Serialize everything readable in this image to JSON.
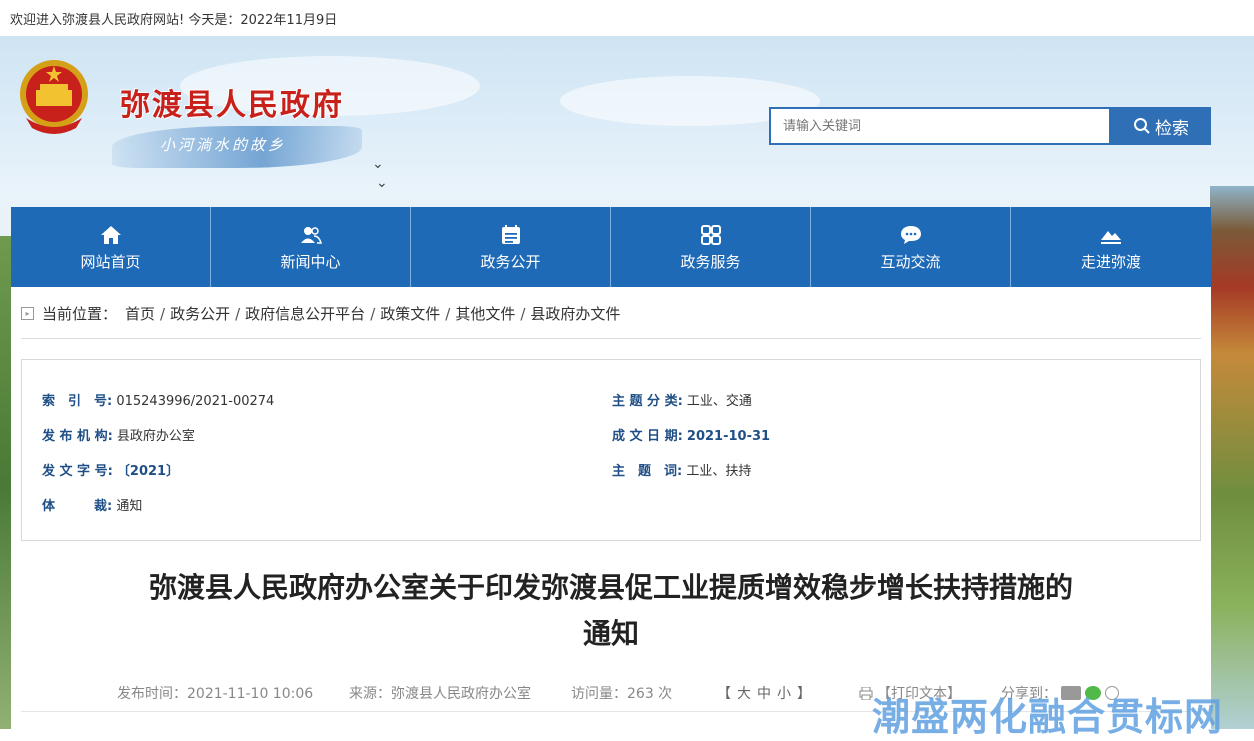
{
  "topbar": {
    "welcome": "欢迎进入弥渡县人民政府网站! 今天是：2022年11月9日"
  },
  "header": {
    "site_title": "弥渡县人民政府",
    "slogan": "小河淌水的故乡",
    "search_placeholder": "请输入关键词",
    "search_button": "检索"
  },
  "nav": {
    "items": [
      {
        "label": "网站首页",
        "icon": "home-icon"
      },
      {
        "label": "新闻中心",
        "icon": "users-icon"
      },
      {
        "label": "政务公开",
        "icon": "calendar-list-icon"
      },
      {
        "label": "政务服务",
        "icon": "grid-icon"
      },
      {
        "label": "互动交流",
        "icon": "chat-icon"
      },
      {
        "label": "走进弥渡",
        "icon": "mountain-icon"
      }
    ]
  },
  "breadcrumb": {
    "label": "当前位置：",
    "items": [
      "首页",
      "政务公开",
      "政府信息公开平台",
      "政策文件",
      "其他文件",
      "县政府办文件"
    ]
  },
  "meta": {
    "index_label": "索　引　号:",
    "index_value": "015243996/2021-00274",
    "topic_label": "主 题 分 类:",
    "topic_value": "工业、交通",
    "org_label": "发 布 机 构:",
    "org_value": "县政府办公室",
    "date_label": "成 文 日 期:",
    "date_value": "2021-10-31",
    "docno_label": "发 文 字 号:",
    "docno_value": "〔2021〕",
    "keywords_label": "主　题　词:",
    "keywords_value": "工业、扶持",
    "genre_label": "体　　　裁:",
    "genre_value": "通知"
  },
  "article": {
    "title_line1": "弥渡县人民政府办公室关于印发弥渡县促工业提质增效稳步增长扶持措施的",
    "title_line2": "通知",
    "publish_time": "发布时间：2021-11-10 10:06",
    "source": "来源：弥渡县人民政府办公室",
    "views": "访问量：263 次",
    "font_ctrl_open": "【",
    "font_large": "大",
    "font_medium": "中",
    "font_small": "小",
    "font_ctrl_close": "】",
    "print": "【打印文本】",
    "share": "分享到："
  },
  "watermark": "潮盛两化融合贯标网",
  "colors": {
    "nav_bg": "#1f6ab7",
    "title_red": "#c8201a",
    "label_blue": "#1f4f86"
  }
}
